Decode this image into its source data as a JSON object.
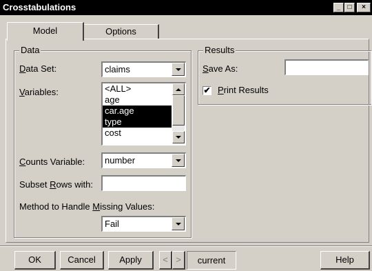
{
  "window": {
    "title": "Crosstabulations",
    "controls": [
      "_",
      "□",
      "×"
    ]
  },
  "tabs": [
    {
      "label": "Model",
      "active": true
    },
    {
      "label": "Options",
      "active": false
    }
  ],
  "data_group": {
    "legend": "Data",
    "data_set_label": "Data Set:",
    "data_set_value": "claims",
    "variables_label": "Variables:",
    "variables": [
      {
        "label": "<ALL>",
        "selected": false
      },
      {
        "label": "age",
        "selected": false
      },
      {
        "label": "car.age",
        "selected": true
      },
      {
        "label": "type",
        "selected": true
      },
      {
        "label": "cost",
        "selected": false
      }
    ],
    "counts_label": "Counts Variable:",
    "counts_value": "number",
    "subset_label": "Subset Rows with:",
    "subset_value": "",
    "missing_label": "Method to Handle Missing Values:",
    "missing_value": "Fail"
  },
  "results_group": {
    "legend": "Results",
    "save_as_label": "Save As:",
    "save_as_value": "",
    "print_results_label": "Print Results",
    "print_results_checked": true,
    "check_mark": "✔"
  },
  "buttons": {
    "ok": "OK",
    "cancel": "Cancel",
    "apply": "Apply",
    "prev": "<",
    "next": ">",
    "current": "current",
    "help": "Help"
  }
}
